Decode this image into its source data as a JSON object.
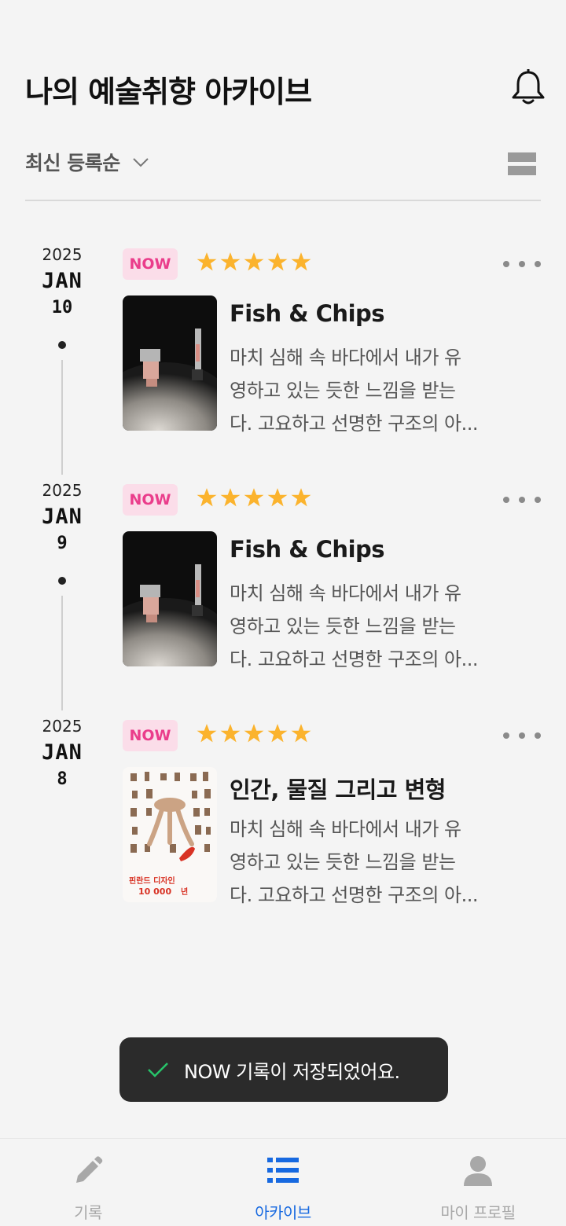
{
  "header": {
    "title": "나의 예술취향 아카이브",
    "bell_icon": "bell-icon"
  },
  "toolbar": {
    "sort_label": "최신 등록순",
    "view_icon": "list-view-icon"
  },
  "entries": [
    {
      "year": "2025",
      "month": "JAN",
      "day": "10",
      "badge": "NOW",
      "rating": 5,
      "title": "Fish & Chips",
      "desc_lines": [
        "마치 심해 속 바다에서 내가 유",
        "영하고 있는 듯한 느낌을 받는",
        "다. 고요하고 선명한 구조의 아..."
      ],
      "thumb": "sculpture-photo"
    },
    {
      "year": "2025",
      "month": "JAN",
      "day": "9",
      "badge": "NOW",
      "rating": 5,
      "title": "Fish & Chips",
      "desc_lines": [
        "마치 심해 속 바다에서 내가 유",
        "영하고 있는 듯한 느낌을 받는",
        "다. 고요하고 선명한 구조의 아..."
      ],
      "thumb": "sculpture-photo"
    },
    {
      "year": "2025",
      "month": "JAN",
      "day": "8",
      "badge": "NOW",
      "rating": 5,
      "title": "인간, 물질 그리고 변형",
      "desc_lines": [
        "마치 심해 속 바다에서 내가 유",
        "영하고 있는 듯한 느낌을 받는",
        "다. 고요하고 선명한 구조의 아..."
      ],
      "thumb": "exhibition-poster"
    }
  ],
  "toast": {
    "text": "NOW 기록이 저장되었어요."
  },
  "nav": {
    "items": [
      {
        "label": "기록",
        "icon": "pencil-icon"
      },
      {
        "label": "아카이브",
        "icon": "list-icon",
        "active": true
      },
      {
        "label": "마이 프로필",
        "icon": "person-icon"
      }
    ]
  },
  "colors": {
    "accent": "#1769e0",
    "badge_text": "#ea3d8b",
    "badge_bg": "#fbdde9",
    "star": "#fbb32d",
    "toast_check": "#27c46a"
  }
}
